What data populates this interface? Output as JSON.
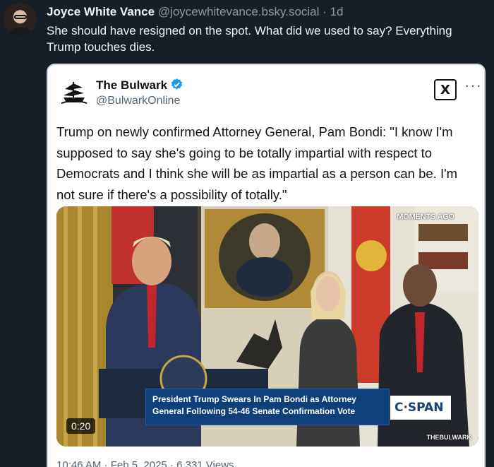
{
  "post": {
    "author_name": "Joyce White Vance",
    "author_handle": "@joycewhitevance.bsky.social",
    "separator": "·",
    "age": "1d",
    "text": "She should have resigned on the spot. What did we used to say? Everything Trump touches dies."
  },
  "quote": {
    "name": "The Bulwark",
    "handle": "@BulwarkOnline",
    "x_logo": "X",
    "more": "···",
    "text": "Trump on newly confirmed Attorney General, Pam Bondi: \"I know I'm supposed to say she's going to be totally impartial with respect to Democrats and I think she will be as impartial as a person can be. I'm not sure if there's a possibility of totally.\"",
    "video": {
      "moments": "MOMENTS AGO",
      "chyron_line1": "President Trump Swears In Pam Bondi as Attorney",
      "chyron_line2": "General Following 54-46 Senate Confirmation Vote",
      "network": "C·SPAN",
      "duration": "0:20",
      "watermark": "THEBULWARK"
    },
    "footer": "10:46 AM · Feb 5, 2025 · 6,331 Views"
  },
  "colors": {
    "background": "#161e27",
    "verified": "#1d9bf0",
    "chyron": "#10407a"
  },
  "icons": [
    "avatar",
    "bulwark-ship-logo",
    "verified-badge-icon",
    "x-logo-icon",
    "more-icon"
  ]
}
